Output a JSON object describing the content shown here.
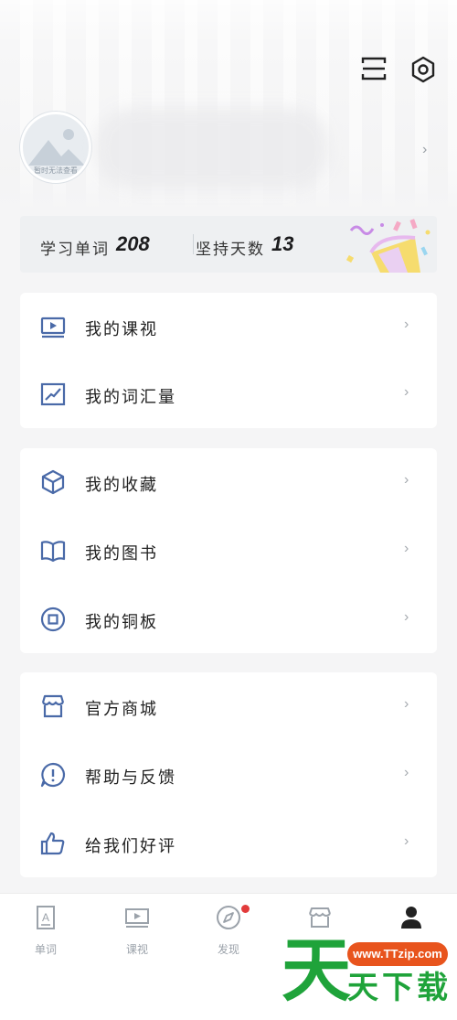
{
  "header": {
    "avatar_caption": "暂时无法查看",
    "scan_icon": "scan-icon",
    "settings_icon": "settings-icon",
    "chevron": "›"
  },
  "stats": {
    "words_label": "学习单词",
    "words_value": "208",
    "days_label": "坚持天数",
    "days_value": "13"
  },
  "menu": {
    "group1": [
      {
        "label": "我的课视",
        "icon": "video-icon"
      },
      {
        "label": "我的词汇量",
        "icon": "chart-icon"
      }
    ],
    "group2": [
      {
        "label": "我的收藏",
        "icon": "cube-icon"
      },
      {
        "label": "我的图书",
        "icon": "book-icon"
      },
      {
        "label": "我的铜板",
        "icon": "coin-icon"
      }
    ],
    "group3": [
      {
        "label": "官方商城",
        "icon": "store-icon"
      },
      {
        "label": "帮助与反馈",
        "icon": "help-icon"
      },
      {
        "label": "给我们好评",
        "icon": "thumbs-up-icon"
      }
    ],
    "chevron": "›"
  },
  "tabbar": {
    "tabs": [
      {
        "label": "单词",
        "icon": "word-icon"
      },
      {
        "label": "课视",
        "icon": "video-icon"
      },
      {
        "label": "发现",
        "icon": "compass-icon",
        "badge": true
      },
      {
        "label": "",
        "icon": "store-icon"
      },
      {
        "label": "",
        "icon": "user-icon",
        "active": true
      }
    ]
  },
  "watermark": {
    "big": "天",
    "url": "www.TTzip.com",
    "sub": "天下载"
  },
  "colors": {
    "accent": "#3b5ea8",
    "icon_blue": "#4a6aa8",
    "badge_red": "#e23b3b",
    "watermark_green": "#1fa33a",
    "watermark_orange": "#e8541d"
  }
}
